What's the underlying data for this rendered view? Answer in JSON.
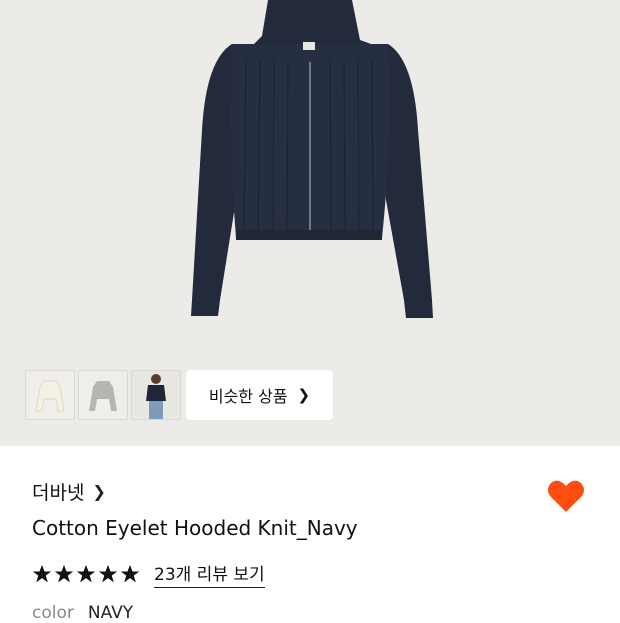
{
  "gallery": {
    "main_image": "navy-hooded-zip-knit-photo",
    "thumbnails": [
      {
        "name": "ivory-variant-thumbnail"
      },
      {
        "name": "grey-variant-thumbnail"
      },
      {
        "name": "model-wearing-thumbnail"
      }
    ],
    "similar_button_label": "비슷한 상품",
    "similar_button_icon": "chevron-right-icon"
  },
  "product": {
    "brand": "더바넷",
    "brand_icon": "chevron-right-icon",
    "title": "Cotton Eyelet Hooded Knit_Navy",
    "rating_stars": 5,
    "review_link": "23개 리뷰 보기",
    "wishlist_icon": "heart-icon",
    "wishlist_color": "#ff4d12",
    "color_label": "color",
    "color_value": "NAVY"
  }
}
